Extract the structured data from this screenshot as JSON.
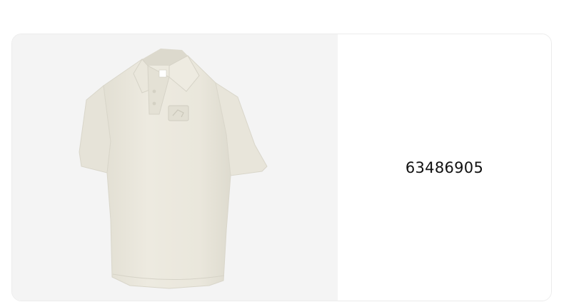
{
  "product": {
    "code": "63486905",
    "image": {
      "subject": "polo-shirt",
      "color": "#ebe8dd",
      "background": "#f4f4f4"
    }
  }
}
